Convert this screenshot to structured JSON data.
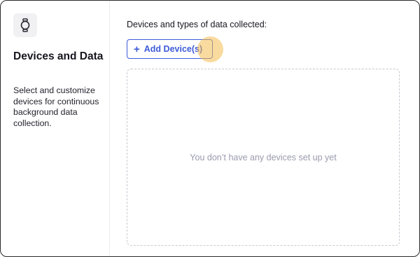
{
  "sidebar": {
    "icon": "watch-icon",
    "title": "Devices and Data",
    "description": "Select and customize devices for continuous background data collection."
  },
  "main": {
    "section_label": "Devices and types of data collected:",
    "add_button": {
      "icon": "plus-icon",
      "label": "Add Device(s)"
    },
    "empty_state": "You don’t have any devices set up yet"
  },
  "colors": {
    "accent": "#3d5bd9",
    "highlight": "#f5be50",
    "muted_text": "#9a9aae"
  }
}
